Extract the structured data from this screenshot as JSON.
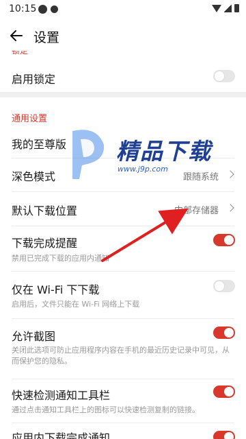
{
  "status_bar": {
    "time": "10:15"
  },
  "header": {
    "title": "设置"
  },
  "lock": {
    "title": "启用锁定",
    "enabled": false
  },
  "general": {
    "section_title": "通用设置",
    "supreme": {
      "title": "我的至尊版"
    },
    "dark_mode": {
      "title": "深色模式",
      "value": "跟随系统"
    },
    "download_location": {
      "title": "默认下载位置",
      "value": "内部存储器"
    },
    "download_complete": {
      "title": "下载完成提醒",
      "subtitle": "禁用已完成下载的应用内通知",
      "enabled": true
    },
    "wifi_only": {
      "title": "仅在 Wi-Fi 下下载",
      "subtitle": "启用后，文件只能在 Wi-Fi 网络上下载",
      "enabled": false
    },
    "screenshot": {
      "title": "允许截图",
      "subtitle": "关闭此选项可防止应用程序内容在手机的最近历史记录中可见，从而保护您的隐私。",
      "enabled": true
    },
    "quick_detect": {
      "title": "快速检测通知工具栏",
      "subtitle": "通过点击通知工具栏上的图标可以快速检测复制的链接。",
      "enabled": true
    },
    "in_app_download": {
      "title": "应用内下载完成通知",
      "enabled": true
    }
  },
  "watermark": {
    "brand": "精品下载",
    "url": "www.j9p.com"
  },
  "colors": {
    "accent": "#d8372b",
    "section_title": "#d23a2a",
    "arrow": "#e02020"
  }
}
